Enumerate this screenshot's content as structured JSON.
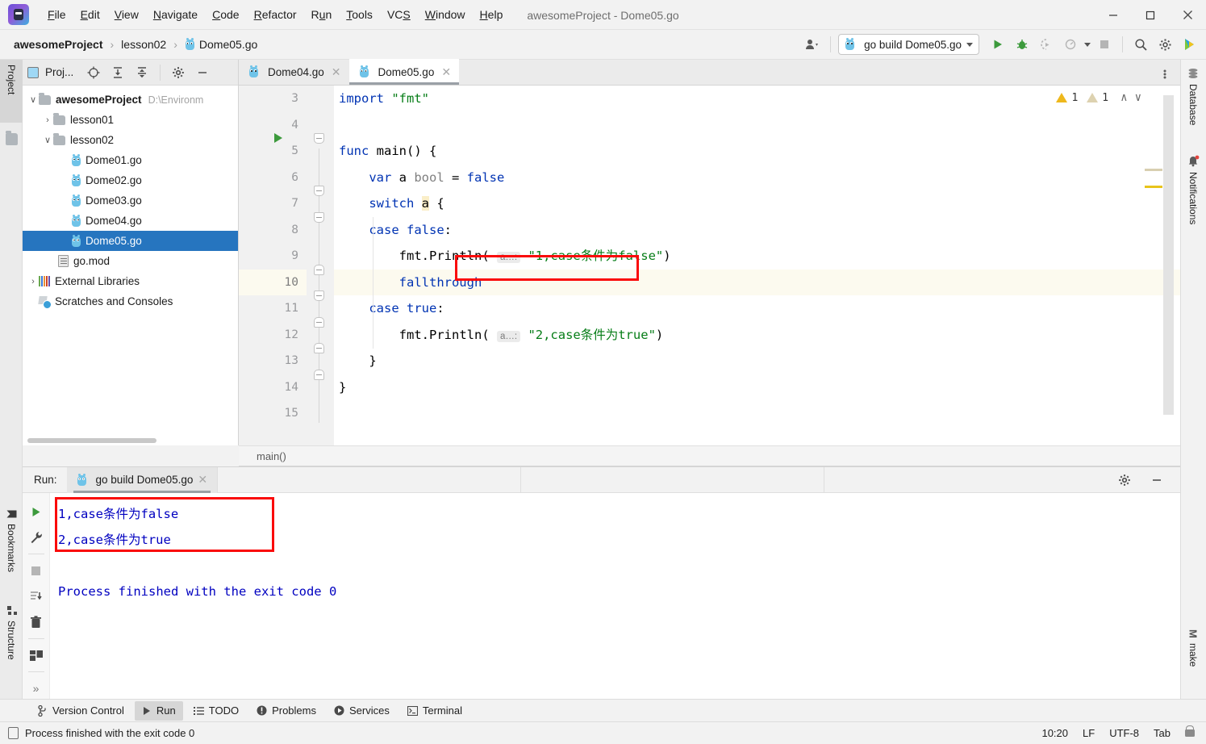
{
  "window": {
    "title": "awesomeProject - Dome05.go",
    "minimize": "─",
    "maximize": "☐",
    "close": "✕"
  },
  "menu": {
    "items": [
      "File",
      "Edit",
      "View",
      "Navigate",
      "Code",
      "Refactor",
      "Run",
      "Tools",
      "VCS",
      "Window",
      "Help"
    ]
  },
  "breadcrumb": {
    "project": "awesomeProject",
    "folder": "lesson02",
    "file": "Dome05.go",
    "separator": "›"
  },
  "toolbar": {
    "run_config": "go build Dome05.go",
    "run_icon": "run-icon",
    "debug_icon": "debug-icon",
    "coverage_icon": "run-with-coverage-icon",
    "profile_icon": "profiler-icon",
    "stop_icon": "stop-icon",
    "search_icon": "search-icon",
    "settings_icon": "gear-icon",
    "updates_icon": "ide-update-icon",
    "account_icon": "account-icon"
  },
  "left_tool_tabs": [
    {
      "label": "Project",
      "active": true
    },
    {
      "label": "Bookmarks",
      "active": false
    },
    {
      "label": "Structure",
      "active": false
    }
  ],
  "right_tool_tabs": [
    {
      "label": "Database"
    },
    {
      "label": "Notifications"
    },
    {
      "label": "make"
    }
  ],
  "project_panel": {
    "title": "Proj...",
    "actions": [
      "locate-icon",
      "expand-all-icon",
      "collapse-all-icon",
      "gear-icon",
      "hide-icon"
    ],
    "tree": [
      {
        "label": "awesomeProject",
        "suffix": "D:\\Environm",
        "depth": 0,
        "arrow": "∨",
        "icon": "folder",
        "bold": true,
        "selected": false
      },
      {
        "label": "lesson01",
        "suffix": "",
        "depth": 1,
        "arrow": "›",
        "icon": "folder",
        "bold": false,
        "selected": false
      },
      {
        "label": "lesson02",
        "suffix": "",
        "depth": 1,
        "arrow": "∨",
        "icon": "folder",
        "bold": false,
        "selected": false
      },
      {
        "label": "Dome01.go",
        "suffix": "",
        "depth": 2,
        "arrow": "",
        "icon": "go-file",
        "bold": false,
        "selected": false
      },
      {
        "label": "Dome02.go",
        "suffix": "",
        "depth": 2,
        "arrow": "",
        "icon": "go-file",
        "bold": false,
        "selected": false
      },
      {
        "label": "Dome03.go",
        "suffix": "",
        "depth": 2,
        "arrow": "",
        "icon": "go-file",
        "bold": false,
        "selected": false
      },
      {
        "label": "Dome04.go",
        "suffix": "",
        "depth": 2,
        "arrow": "",
        "icon": "go-file",
        "bold": false,
        "selected": false
      },
      {
        "label": "Dome05.go",
        "suffix": "",
        "depth": 2,
        "arrow": "",
        "icon": "go-file",
        "bold": false,
        "selected": true
      },
      {
        "label": "go.mod",
        "suffix": "",
        "depth": 2,
        "arrow": "",
        "icon": "gomod-file",
        "bold": false,
        "selected": false
      },
      {
        "label": "External Libraries",
        "suffix": "",
        "depth": 0,
        "arrow": "›",
        "icon": "libraries",
        "bold": false,
        "selected": false
      },
      {
        "label": "Scratches and Consoles",
        "suffix": "",
        "depth": 0,
        "arrow": "",
        "icon": "scratches",
        "bold": false,
        "selected": false
      }
    ]
  },
  "editor": {
    "tabs": [
      {
        "label": "Dome04.go",
        "active": false
      },
      {
        "label": "Dome05.go",
        "active": true
      }
    ],
    "close_glyph": "✕",
    "first_line_number": 3,
    "line_numbers": [
      3,
      4,
      5,
      6,
      7,
      8,
      9,
      10,
      11,
      12,
      13,
      14,
      15
    ],
    "current_line": 10,
    "inspections": {
      "warning_count": "1",
      "weak_warning_count": "1",
      "prev_glyph": "∧",
      "next_glyph": "∨"
    },
    "breadcrumb_bottom": "main()",
    "inlay_hint": "a…:",
    "lines": [
      {
        "n": 3,
        "tokens": [
          {
            "t": "import ",
            "c": "kw"
          },
          {
            "t": "\"fmt\"",
            "c": "str"
          }
        ],
        "indent": 0
      },
      {
        "n": 4,
        "tokens": [],
        "indent": 0
      },
      {
        "n": 5,
        "tokens": [
          {
            "t": "func ",
            "c": "kw"
          },
          {
            "t": "main",
            "c": "pl"
          },
          {
            "t": "() {",
            "c": "pl"
          }
        ],
        "indent": 0
      },
      {
        "n": 6,
        "tokens": [
          {
            "t": "var ",
            "c": "kw"
          },
          {
            "t": "a ",
            "c": "pl"
          },
          {
            "t": "bool",
            "c": "typ"
          },
          {
            "t": " = ",
            "c": "pl"
          },
          {
            "t": "false",
            "c": "kw"
          }
        ],
        "indent": 1
      },
      {
        "n": 7,
        "tokens": [
          {
            "t": "switch ",
            "c": "kw"
          },
          {
            "t": "a",
            "c": "hl"
          },
          {
            "t": " {",
            "c": "pl"
          }
        ],
        "indent": 1
      },
      {
        "n": 8,
        "tokens": [
          {
            "t": "case ",
            "c": "kw"
          },
          {
            "t": "false",
            "c": "kw"
          },
          {
            "t": ":",
            "c": "pl"
          }
        ],
        "indent": 1
      },
      {
        "n": 9,
        "tokens": [
          {
            "t": "fmt",
            "c": "pl"
          },
          {
            "t": ".",
            "c": "pl"
          },
          {
            "t": "Println",
            "c": "pl"
          },
          {
            "t": "( ",
            "c": "pl"
          },
          {
            "t": "HINT",
            "c": "hint"
          },
          {
            "t": " ",
            "c": "pl"
          },
          {
            "t": "\"1,case条件为false\"",
            "c": "str"
          },
          {
            "t": ")",
            "c": "pl"
          }
        ],
        "indent": 2
      },
      {
        "n": 10,
        "tokens": [
          {
            "t": "fallthrough",
            "c": "kw"
          }
        ],
        "indent": 2
      },
      {
        "n": 11,
        "tokens": [
          {
            "t": "case ",
            "c": "kw"
          },
          {
            "t": "true",
            "c": "kw"
          },
          {
            "t": ":",
            "c": "pl"
          }
        ],
        "indent": 1
      },
      {
        "n": 12,
        "tokens": [
          {
            "t": "fmt",
            "c": "pl"
          },
          {
            "t": ".",
            "c": "pl"
          },
          {
            "t": "Println",
            "c": "pl"
          },
          {
            "t": "( ",
            "c": "pl"
          },
          {
            "t": "HINT",
            "c": "hint"
          },
          {
            "t": " ",
            "c": "pl"
          },
          {
            "t": "\"2,case条件为true\"",
            "c": "str"
          },
          {
            "t": ")",
            "c": "pl"
          }
        ],
        "indent": 2
      },
      {
        "n": 13,
        "tokens": [
          {
            "t": "}",
            "c": "pl"
          }
        ],
        "indent": 1
      },
      {
        "n": 14,
        "tokens": [
          {
            "t": "}",
            "c": "pl"
          }
        ],
        "indent": 0
      },
      {
        "n": 15,
        "tokens": [],
        "indent": 0
      }
    ],
    "highlight_box_label": "fallthrough"
  },
  "run_panel": {
    "label": "Run:",
    "tab": "go build Dome05.go",
    "close_glyph": "✕",
    "settings_icon": "gear-icon",
    "hide_icon": "minimize-icon",
    "tools": [
      "rerun-icon",
      "wrench-icon",
      "stop-icon",
      "soft-wrap-icon",
      "trash-icon",
      "print-icon",
      "more-icon"
    ],
    "more_glyph": "»",
    "console_lines": [
      "1,case条件为false",
      "2,case条件为true",
      "",
      "Process finished with the exit code 0"
    ]
  },
  "bottom_tabs": [
    {
      "label": "Version Control",
      "icon": "branch-icon",
      "active": false
    },
    {
      "label": "Run",
      "icon": "run-icon",
      "active": true
    },
    {
      "label": "TODO",
      "icon": "todo-icon",
      "active": false
    },
    {
      "label": "Problems",
      "icon": "problems-icon",
      "active": false
    },
    {
      "label": "Services",
      "icon": "services-icon",
      "active": false
    },
    {
      "label": "Terminal",
      "icon": "terminal-icon",
      "active": false
    }
  ],
  "status_bar": {
    "message": "Process finished with the exit code 0",
    "caret_position": "10:20",
    "line_separator": "LF",
    "encoding": "UTF-8",
    "indent": "Tab",
    "lock_icon": "unlocked-icon"
  },
  "colors": {
    "accent_selection": "#2675bf",
    "highlight_box": "#fa0a0a",
    "keyword": "#0033b3",
    "string": "#067d17",
    "console_text": "#0000c0",
    "warning": "#eeb81c",
    "weak_warning": "#ddd2b0",
    "run_green": "#3c9a3c"
  }
}
